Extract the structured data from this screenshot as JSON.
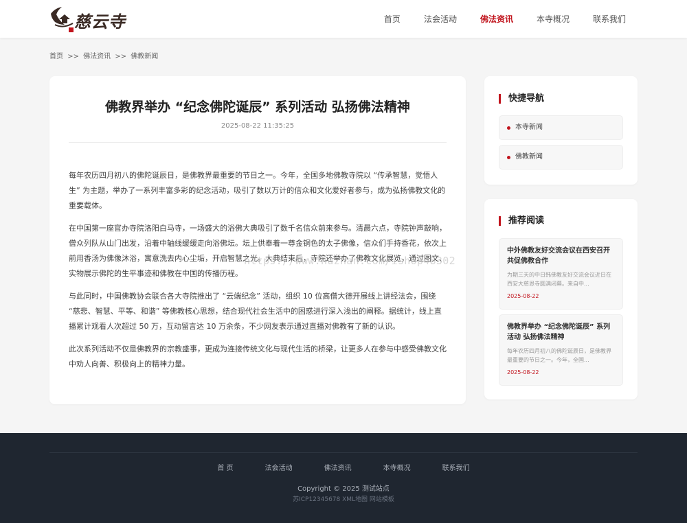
{
  "header": {
    "logo_text": "慈云寺",
    "nav": [
      {
        "label": "首页"
      },
      {
        "label": "法会活动"
      },
      {
        "label": "佛法资讯",
        "active": true
      },
      {
        "label": "本寺概况"
      },
      {
        "label": "联系我们"
      }
    ]
  },
  "breadcrumb": {
    "items": [
      "首页",
      "佛法资讯",
      "佛教新闻"
    ],
    "separator": ">>"
  },
  "article": {
    "title": "佛教界举办 “纪念佛陀诞辰” 系列活动 弘扬佛法精神",
    "date": "2025-08-22 11:35:25",
    "paragraphs": [
      "每年农历四月初八的佛陀诞辰日，是佛教界最重要的节日之一。今年，全国多地佛教寺院以 “传承智慧，觉悟人生” 为主题，举办了一系列丰富多彩的纪念活动，吸引了数以万计的信众和文化爱好者参与，成为弘扬佛教文化的重要载体。",
      "在中国第一座官办寺院洛阳白马寺，一场盛大的浴佛大典吸引了数千名信众前来参与。清晨六点，寺院钟声敲响，僧众列队从山门出发，沿着中轴线缓缓走向浴佛坛。坛上供奉着一尊金铜色的太子佛像，信众们手持香花，依次上前用香汤为佛像沐浴，寓意洗去内心尘垢，开启智慧之光。大典结束后，寺院还举办了佛教文化展览，通过图文、实物展示佛陀的生平事迹和佛教在中国的传播历程。",
      "与此同时，中国佛教协会联合各大寺院推出了 “云端纪念” 活动，组织 10 位高僧大德开展线上讲经法会，围绕 “慈悲、智慧、平等、和谐” 等佛教核心思想，结合现代社会生活中的困惑进行深入浅出的阐释。据统计，线上直播累计观看人次超过 50 万，互动留言达 10 万余条，不少网友表示通过直播对佛教有了新的认识。",
      "此次系列活动不仅是佛教界的宗教盛事，更成为连接传统文化与现代生活的桥梁，让更多人在参与中感受佛教文化中劝人向善、积极向上的精神力量。"
    ]
  },
  "watermark": "https://www.huzhan.com/ishop48302",
  "sidebar": {
    "quick_nav": {
      "title": "快捷导航",
      "items": [
        {
          "label": "本寺新闻"
        },
        {
          "label": "佛教新闻"
        }
      ]
    },
    "recommend": {
      "title": "推荐阅读",
      "items": [
        {
          "title": "中外佛教友好交流会议在西安召开 共促佛教合作",
          "excerpt": "为期三天的中日韩佛教友好交流会议近日在西安大慈恩寺圆满闭幕。来自中...",
          "date": "2025-08-22"
        },
        {
          "title": "佛教界举办 “纪念佛陀诞辰” 系列活动 弘扬佛法精神",
          "excerpt": "每年农历四月初八的佛陀诞辰日，是佛教界最重要的节日之一。今年，全国...",
          "date": "2025-08-22"
        }
      ]
    }
  },
  "footer": {
    "nav": [
      {
        "label": "首 页"
      },
      {
        "label": "法会活动"
      },
      {
        "label": "佛法资讯"
      },
      {
        "label": "本寺概况"
      },
      {
        "label": "联系我们"
      }
    ],
    "copyright": "Copyright © 2025 测试站点",
    "icp": "苏ICP12345678 XML地图 网站模板"
  },
  "colors": {
    "accent": "#c1141d",
    "footer_bg": "#1f2630",
    "page_bg": "#f5f5f5"
  }
}
